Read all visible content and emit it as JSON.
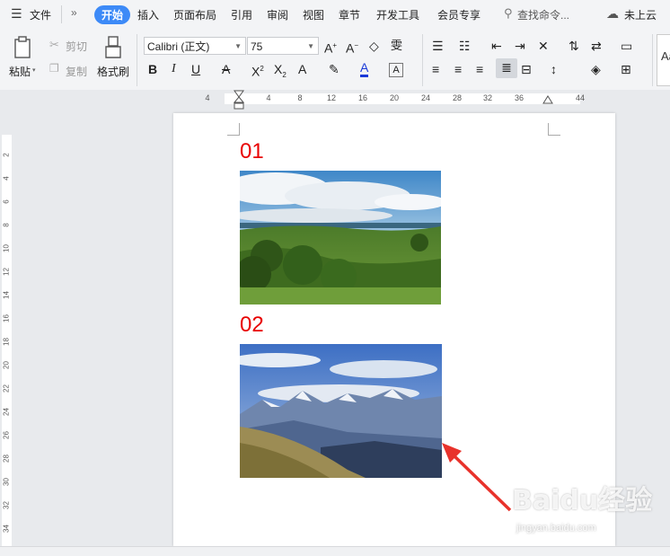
{
  "menubar": {
    "file": "文件",
    "tabs": [
      "开始",
      "插入",
      "页面布局",
      "引用",
      "审阅",
      "视图",
      "章节",
      "开发工具",
      "会员专享"
    ],
    "active_tab": "开始",
    "search_placeholder": "查找命令...",
    "cloud_status": "未上云"
  },
  "ribbon": {
    "paste": "粘贴",
    "cut": "剪切",
    "copy": "复制",
    "format_painter": "格式刷",
    "font_name": "Calibri (正文)",
    "font_size": "75",
    "style_preview": "Aa"
  },
  "ruler": {
    "h_ticks": [
      "4",
      "4",
      "8",
      "12",
      "16",
      "20",
      "24",
      "28",
      "32",
      "36",
      "44"
    ],
    "v_ticks": [
      "2",
      "4",
      "6",
      "8",
      "10",
      "12",
      "14",
      "16",
      "18",
      "20",
      "22",
      "24",
      "26",
      "28",
      "30",
      "32",
      "34"
    ]
  },
  "document": {
    "heading1": "01",
    "heading2": "02"
  },
  "watermark": {
    "brand": "Baidu经验",
    "url": "jingyan.baidu.com"
  },
  "colors": {
    "accent": "#3d8af7",
    "heading": "#e80000",
    "arrow": "#e8322b"
  }
}
